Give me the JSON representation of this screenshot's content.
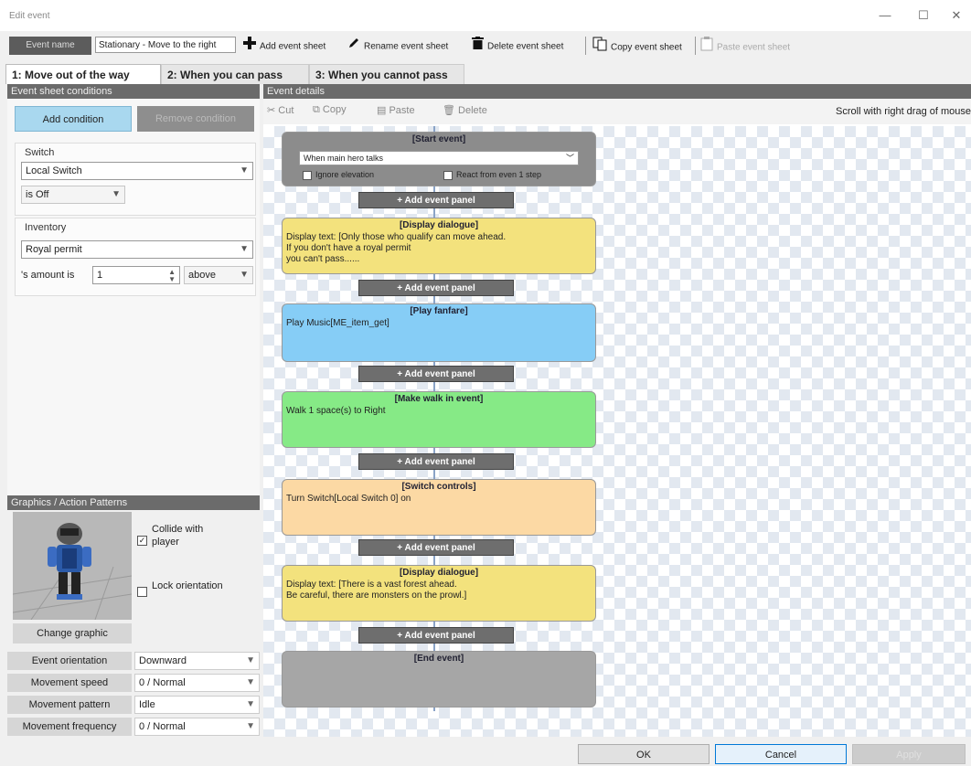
{
  "window": {
    "title": "Edit event",
    "minimize": "—",
    "maximize": "☐",
    "close": "✕"
  },
  "toolbar": {
    "event_name_label": "Event name",
    "event_name_value": "Stationary - Move to the right",
    "add_sheet": "Add event sheet",
    "rename_sheet": "Rename event sheet",
    "delete_sheet": "Delete event sheet",
    "copy_sheet": "Copy event sheet",
    "paste_sheet": "Paste event sheet"
  },
  "tabs": [
    {
      "label": "1: Move out of the way"
    },
    {
      "label": "2: When you can pass"
    },
    {
      "label": "3: When you cannot pass"
    }
  ],
  "conditions": {
    "header": "Event sheet conditions",
    "add_button": "Add condition",
    "remove_button": "Remove condition",
    "switch": {
      "label": "Switch",
      "type_value": "Local Switch",
      "state_value": "is Off"
    },
    "inventory": {
      "label": "Inventory",
      "item_value": "Royal permit",
      "amount_label": "'s amount is",
      "amount_value": "1",
      "compare_value": "above"
    }
  },
  "graphics": {
    "header": "Graphics / Action Patterns",
    "collide_label": "Collide with player",
    "collide_checked": true,
    "lock_label": "Lock orientation",
    "lock_checked": false,
    "change_button": "Change graphic",
    "props": [
      {
        "label": "Event orientation",
        "value": "Downward"
      },
      {
        "label": "Movement speed",
        "value": "0 / Normal"
      },
      {
        "label": "Movement pattern",
        "value": "Idle"
      },
      {
        "label": "Movement frequency",
        "value": "0 / Normal"
      }
    ]
  },
  "details": {
    "header": "Event details",
    "cut": "Cut",
    "copy": "Copy",
    "paste": "Paste",
    "delete": "Delete",
    "scroll_hint": "Scroll with right drag of mouse",
    "add_panel_label": "+ Add event panel",
    "start": {
      "title": "[Start event]",
      "trigger": "When main hero talks",
      "ignore_elevation": "Ignore elevation",
      "react_step": "React from even 1 step"
    },
    "panels": [
      {
        "title": "[Display dialogue]",
        "body": "Display text: [Only those who qualify can move ahead.\n If you don't have a royal permit\n you can't pass......",
        "color": "#f3e27d"
      },
      {
        "title": "[Play fanfare]",
        "body": "Play Music[ME_item_get]",
        "color": "#86cdf6"
      },
      {
        "title": "[Make walk in event]",
        "body": "Walk 1 space(s) to Right",
        "color": "#86ea86"
      },
      {
        "title": "[Switch controls]",
        "body": "Turn Switch[Local Switch 0] on",
        "color": "#fcd9a4"
      },
      {
        "title": "[Display dialogue]",
        "body": "Display text: [There is a vast forest ahead.\n Be careful, there are monsters on the prowl.]",
        "color": "#f3e27d"
      }
    ],
    "end": {
      "title": "[End event]"
    }
  },
  "dialog": {
    "ok": "OK",
    "cancel": "Cancel",
    "apply": "Apply"
  }
}
